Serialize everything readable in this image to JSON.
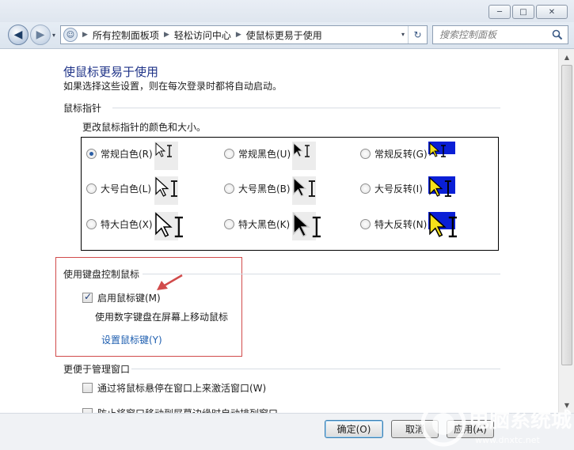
{
  "window": {
    "minimize_label": "─",
    "maximize_label": "□",
    "close_label": "✕"
  },
  "nav": {
    "back_icon": "◀",
    "forward_icon": "▶",
    "dropdown_icon": "▾",
    "address_icon": "☺",
    "breadcrumb": [
      "所有控制面板项",
      "轻松访问中心",
      "使鼠标更易于使用"
    ],
    "breadcrumb_sep": "▶",
    "refresh_icon": "↻",
    "search_placeholder": "搜索控制面板"
  },
  "page": {
    "title": "使鼠标更易于使用",
    "subtitle": "如果选择这些设置，则在每次登录时都将自动启动。"
  },
  "pointer_section": {
    "heading": "鼠标指针",
    "description": "更改鼠标指针的颜色和大小。",
    "options": [
      {
        "label": "常规白色(R)",
        "checked": true,
        "style": "white",
        "size": "normal"
      },
      {
        "label": "常规黑色(U)",
        "checked": false,
        "style": "black",
        "size": "normal"
      },
      {
        "label": "常规反转(G)",
        "checked": false,
        "style": "inverted",
        "size": "normal"
      },
      {
        "label": "大号白色(L)",
        "checked": false,
        "style": "white",
        "size": "large"
      },
      {
        "label": "大号黑色(B)",
        "checked": false,
        "style": "black",
        "size": "large"
      },
      {
        "label": "大号反转(I)",
        "checked": false,
        "style": "inverted",
        "size": "large"
      },
      {
        "label": "特大白色(X)",
        "checked": false,
        "style": "white",
        "size": "extra"
      },
      {
        "label": "特大黑色(K)",
        "checked": false,
        "style": "black",
        "size": "extra"
      },
      {
        "label": "特大反转(N)",
        "checked": false,
        "style": "inverted",
        "size": "extra"
      }
    ]
  },
  "keyboard_section": {
    "heading": "使用键盘控制鼠标",
    "enable_mousekeys_label": "启用鼠标键(M)",
    "enable_mousekeys_checked": true,
    "description": "使用数字键盘在屏幕上移动鼠标",
    "setup_link": "设置鼠标键(Y)"
  },
  "window_section": {
    "heading": "更便于管理窗口",
    "items": [
      {
        "label": "通过将鼠标悬停在窗口上来激活窗口(W)",
        "checked": false
      },
      {
        "label": "防止将窗口移动到屏幕边缘时自动排列窗口",
        "checked": false
      }
    ]
  },
  "buttons": {
    "ok": "确定(O)",
    "cancel": "取消",
    "apply": "应用(A)"
  },
  "watermark": {
    "text": "电脑系统城",
    "url": "www.dnxtc.net"
  },
  "colors": {
    "title_blue": "#1e3287",
    "link_blue": "#1f5fb0",
    "highlight_red": "#d14b4b",
    "inverted_bg": "#0a1fd6",
    "inverted_fg": "#f5e21a"
  }
}
